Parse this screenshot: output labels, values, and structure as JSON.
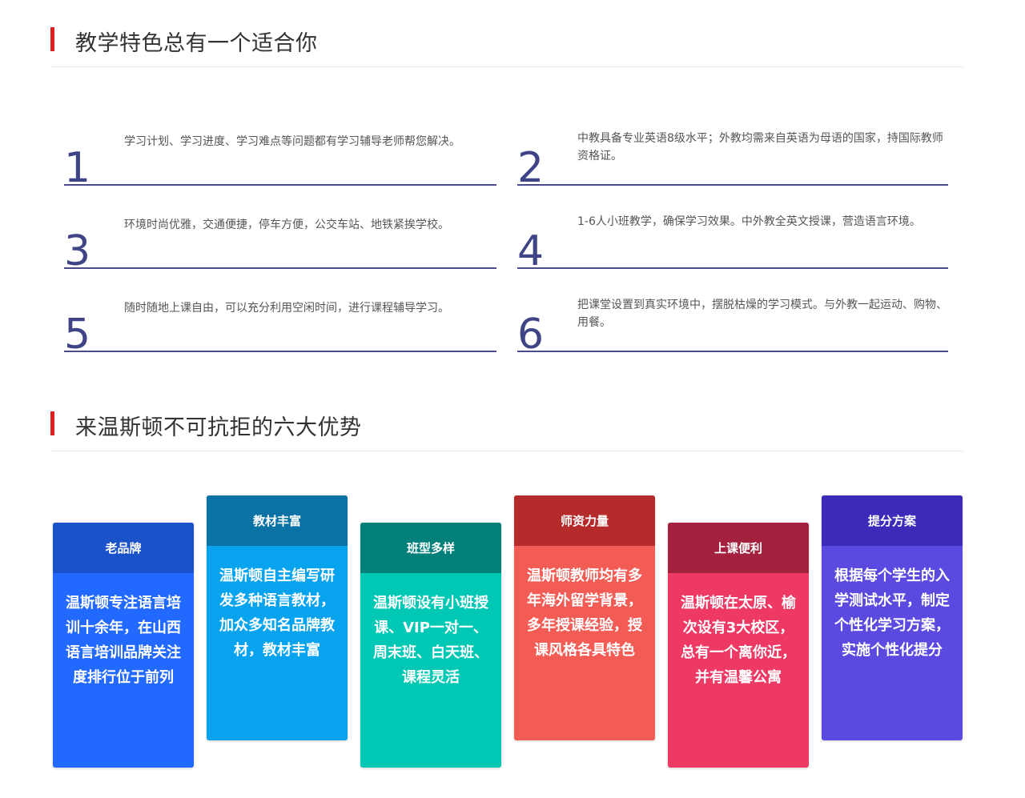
{
  "section1": {
    "title": "教学特色总有一个适合你",
    "features": [
      {
        "num": "1",
        "text": "学习计划、学习进度、学习难点等问题都有学习辅导老师帮您解决。"
      },
      {
        "num": "2",
        "text": "中教具备专业英语8级水平；外教均需来自英语为母语的国家，持国际教师资格证。"
      },
      {
        "num": "3",
        "text": "环境时尚优雅，交通便捷，停车方便，公交车站、地铁紧挨学校。"
      },
      {
        "num": "4",
        "text": "1-6人小班教学，确保学习效果。中外教全英文授课，营造语言环境。"
      },
      {
        "num": "5",
        "text": "随时随地上课自由，可以充分利用空闲时间，进行课程辅导学习。"
      },
      {
        "num": "6",
        "text": "把课堂设置到真实环境中，摆脱枯燥的学习模式。与外教一起运动、购物、用餐。"
      }
    ]
  },
  "section2": {
    "title": "来温斯顿不可抗拒的六大优势",
    "cards": [
      {
        "title": "老品牌",
        "text": "温斯顿专注语言培训十余年，在山西语言培训品牌关注度排行位于前列"
      },
      {
        "title": "教材丰富",
        "text": "温斯顿自主编写研发多种语言教材，加众多知名品牌教材，教材丰富"
      },
      {
        "title": "班型多样",
        "text": "温斯顿设有小班授课、VIP一对一、周末班、白天班、课程灵活"
      },
      {
        "title": "师资力量",
        "text": "温斯顿教师均有多年海外留学背景，多年授课经验，授课风格各具特色"
      },
      {
        "title": "上课便利",
        "text": "温斯顿在太原、榆次设有3大校区，总有一个离你近，并有温馨公寓"
      },
      {
        "title": "提分方案",
        "text": "根据每个学生的入学测试水平，制定个性化学习方案，实施个性化提分"
      }
    ]
  }
}
